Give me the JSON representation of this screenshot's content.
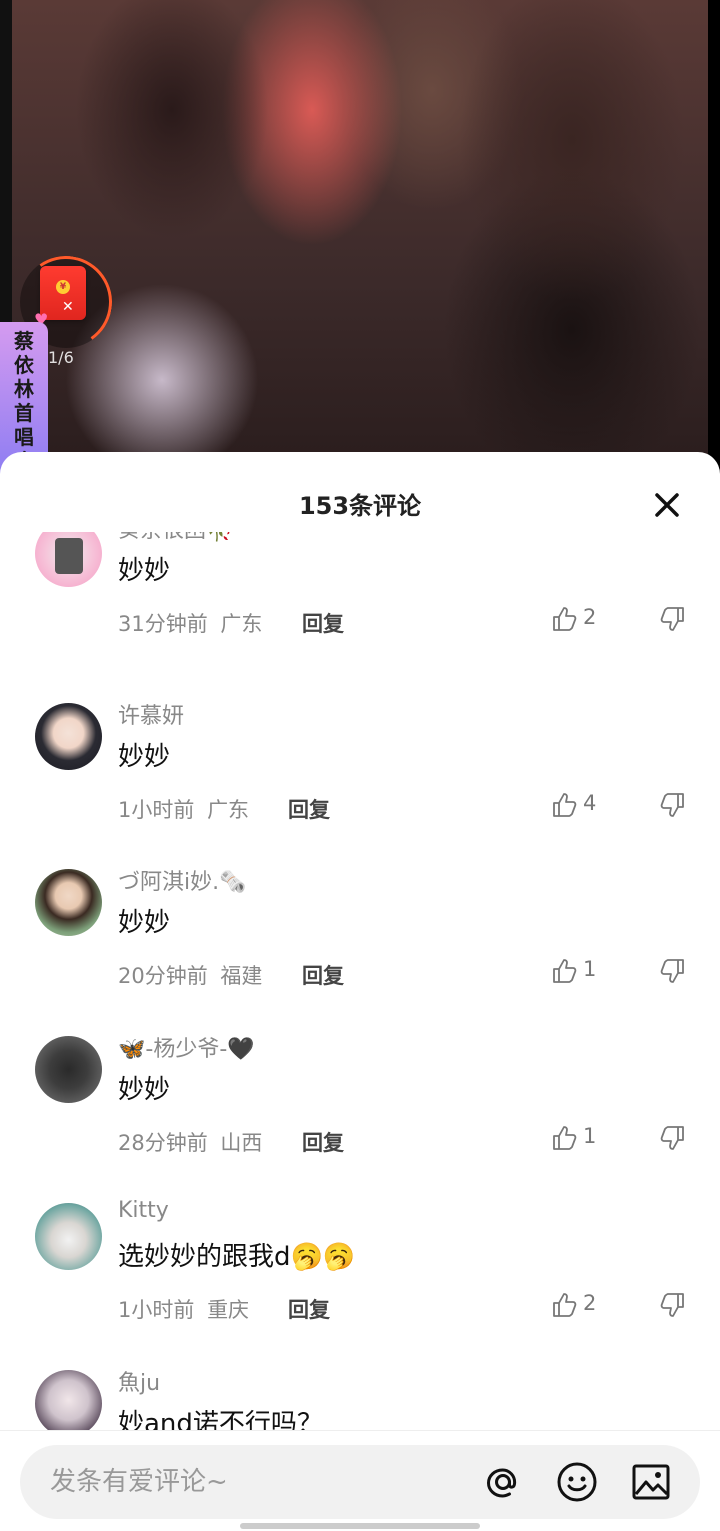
{
  "video": {
    "redpacket_count": "1/6",
    "banner_text": "蔡依林首唱会"
  },
  "sheet": {
    "title": "153条评论"
  },
  "comments": [
    {
      "user": "葵奈很困🥀",
      "text": "妙妙",
      "time": "31分钟前",
      "region": "广东",
      "reply": "回复",
      "likes": "2"
    },
    {
      "user": "许慕妍",
      "text": "妙妙",
      "time": "1小时前",
      "region": "广东",
      "reply": "回复",
      "likes": "4"
    },
    {
      "user": "づ阿淇i妙.🗞️",
      "text": "妙妙",
      "time": "20分钟前",
      "region": "福建",
      "reply": "回复",
      "likes": "1"
    },
    {
      "user": "🦋-杨少爷-🖤",
      "text": "妙妙",
      "time": "28分钟前",
      "region": "山西",
      "reply": "回复",
      "likes": "1"
    },
    {
      "user": "Kitty",
      "text": "选妙妙的跟我d🥱🥱",
      "time": "1小时前",
      "region": "重庆",
      "reply": "回复",
      "likes": "2"
    },
    {
      "user": "魚ju",
      "text": "妙and诺不行吗？",
      "time": "",
      "region": "",
      "reply": "",
      "likes": ""
    }
  ],
  "input": {
    "placeholder": "发条有爱评论~"
  },
  "icons": {
    "close": "close-icon",
    "like": "thumb-up-icon",
    "dislike": "thumb-down-icon",
    "mention": "at-icon",
    "emoji": "emoji-icon",
    "image": "image-icon"
  }
}
